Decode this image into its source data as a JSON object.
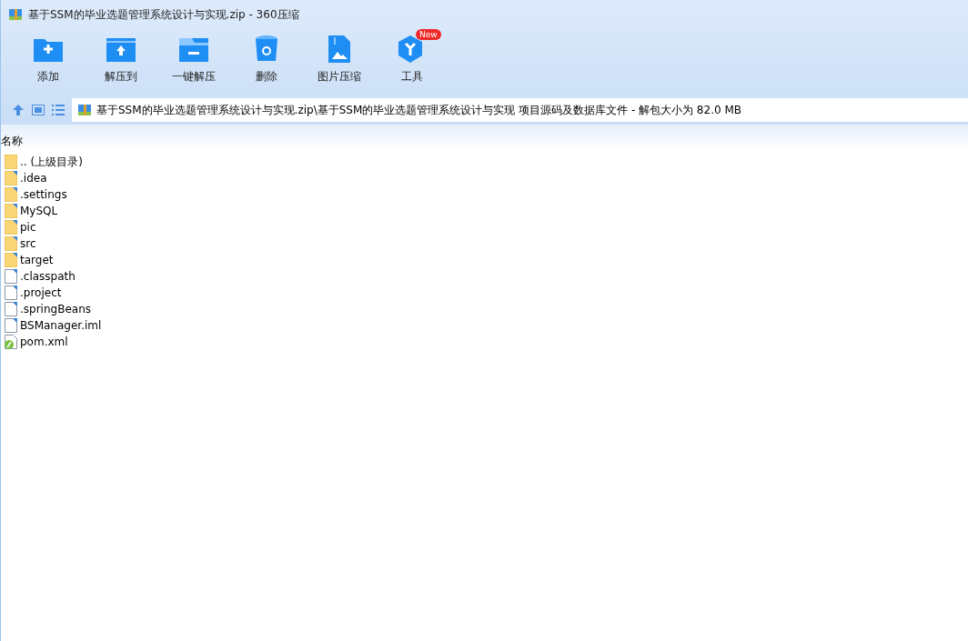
{
  "window": {
    "title": "基于SSM的毕业选题管理系统设计与实现.zip - 360压缩"
  },
  "toolbar": [
    {
      "kind": "add",
      "label": "添加"
    },
    {
      "kind": "extract",
      "label": "解压到"
    },
    {
      "kind": "oneclick",
      "label": "一键解压"
    },
    {
      "kind": "delete",
      "label": "删除"
    },
    {
      "kind": "image",
      "label": "图片压缩"
    },
    {
      "kind": "tools",
      "label": "工具",
      "badge": "New"
    }
  ],
  "address": {
    "path": "基于SSM的毕业选题管理系统设计与实现.zip\\基于SSM的毕业选题管理系统设计与实现 项目源码及数据库文件 - 解包大小为 82.0 MB"
  },
  "file_list": {
    "columns": [
      "名称"
    ],
    "rows": [
      {
        "kind": "parent",
        "name": ".. (上级目录)"
      },
      {
        "kind": "folder",
        "name": ".idea"
      },
      {
        "kind": "folder",
        "name": ".settings"
      },
      {
        "kind": "folder",
        "name": "MySQL"
      },
      {
        "kind": "folder",
        "name": "pic"
      },
      {
        "kind": "folder",
        "name": "src"
      },
      {
        "kind": "folder",
        "name": "target"
      },
      {
        "kind": "file",
        "name": ".classpath"
      },
      {
        "kind": "file",
        "name": ".project"
      },
      {
        "kind": "file",
        "name": ".springBeans"
      },
      {
        "kind": "file",
        "name": "BSManager.iml"
      },
      {
        "kind": "xml",
        "name": "pom.xml"
      }
    ]
  }
}
